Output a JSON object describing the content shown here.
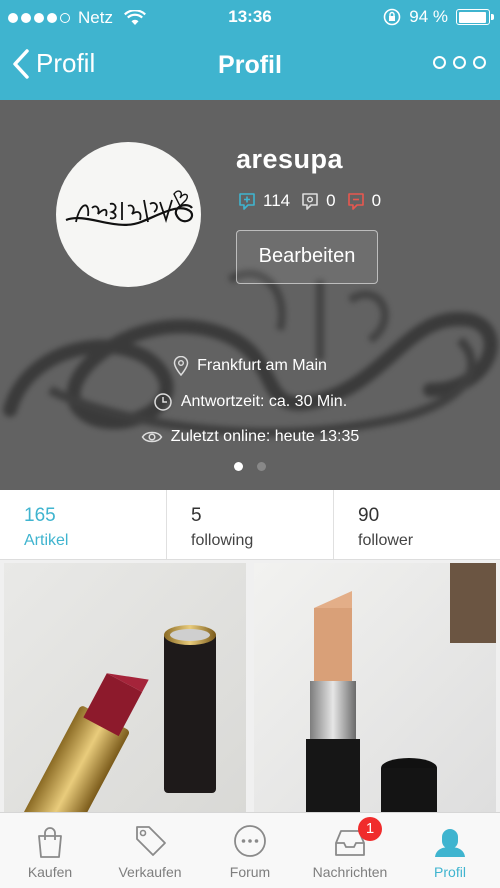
{
  "status_bar": {
    "carrier": "Netz",
    "time": "13:36",
    "battery": "94 %",
    "battery_level": 0.94
  },
  "nav": {
    "back_label": "Profil",
    "title": "Profil"
  },
  "profile": {
    "username": "aresupa",
    "ratings": {
      "positive": "114",
      "neutral": "0",
      "negative": "0"
    },
    "edit_label": "Bearbeiten",
    "location": "Frankfurt am Main",
    "response_time": "Antwortzeit: ca. 30 Min.",
    "last_online": "Zuletzt online: heute 13:35"
  },
  "stats": [
    {
      "value": "165",
      "label": "Artikel"
    },
    {
      "value": "5",
      "label": "following"
    },
    {
      "value": "90",
      "label": "follower"
    }
  ],
  "tabs": [
    {
      "label": "Kaufen",
      "icon": "shopping-bag-icon"
    },
    {
      "label": "Verkaufen",
      "icon": "price-tag-icon"
    },
    {
      "label": "Forum",
      "icon": "chat-bubble-icon"
    },
    {
      "label": "Nachrichten",
      "icon": "inbox-tray-icon",
      "badge": "1"
    },
    {
      "label": "Profil",
      "icon": "person-icon"
    }
  ],
  "colors": {
    "accent": "#3fb4cf",
    "badge": "#f02c2c",
    "header_bg": "#626262"
  }
}
